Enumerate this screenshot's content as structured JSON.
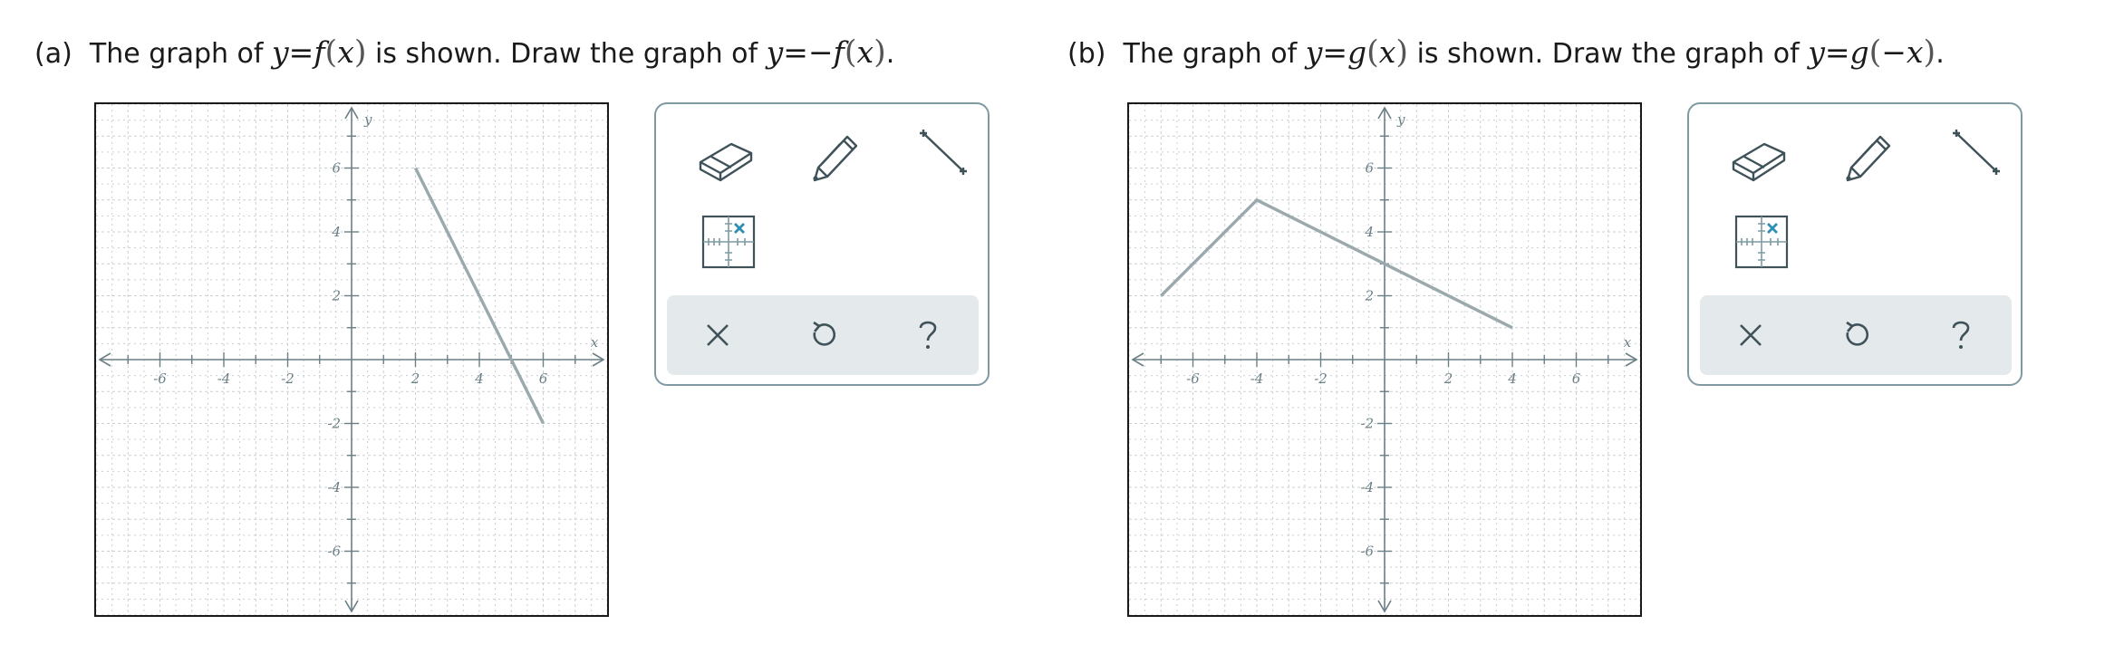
{
  "problems": [
    {
      "label": "(a)",
      "prompt": {
        "lead": "The graph of",
        "given_lhs": "y=f",
        "given_arg": "x",
        "middle": "is shown. Draw the graph of",
        "target_lhs": "y=−f",
        "target_arg": "x",
        "end": "."
      },
      "graph": {
        "x_axis_label": "x",
        "y_axis_label": "y",
        "x_ticks": [
          "-6",
          "-4",
          "-2",
          "2",
          "4",
          "6"
        ],
        "y_ticks": [
          "6",
          "4",
          "2",
          "-2",
          "-4",
          "-6"
        ],
        "range": [
          -8,
          8
        ],
        "curve": [
          [
            2,
            6
          ],
          [
            6,
            -2
          ]
        ]
      }
    },
    {
      "label": "(b)",
      "prompt": {
        "lead": "The graph of",
        "given_lhs": "y=g",
        "given_arg": "x",
        "middle": "is shown. Draw the graph of",
        "target_lhs": "y=g",
        "target_arg": "−x",
        "end": "."
      },
      "graph": {
        "x_axis_label": "x",
        "y_axis_label": "y",
        "x_ticks": [
          "-6",
          "-4",
          "-2",
          "2",
          "4",
          "6"
        ],
        "y_ticks": [
          "6",
          "4",
          "2",
          "-2",
          "-4",
          "-6"
        ],
        "range": [
          -8,
          8
        ],
        "curve": [
          [
            -7,
            2
          ],
          [
            -4,
            5
          ],
          [
            0,
            3
          ],
          [
            4,
            1
          ]
        ]
      }
    }
  ],
  "toolbox": {
    "tools": [
      "eraser-icon",
      "pencil-icon",
      "line-segment-icon",
      "point-grid-icon"
    ],
    "actions": [
      "clear-icon",
      "undo-icon",
      "help-icon"
    ]
  },
  "colors": {
    "curve": "#9aa9ae",
    "axis": "#6b7f86",
    "grid": "#c9d0d3",
    "toolbox_border": "#7f9aa2",
    "action_bar": "#e4e9ec",
    "icon": "#3f5259"
  }
}
